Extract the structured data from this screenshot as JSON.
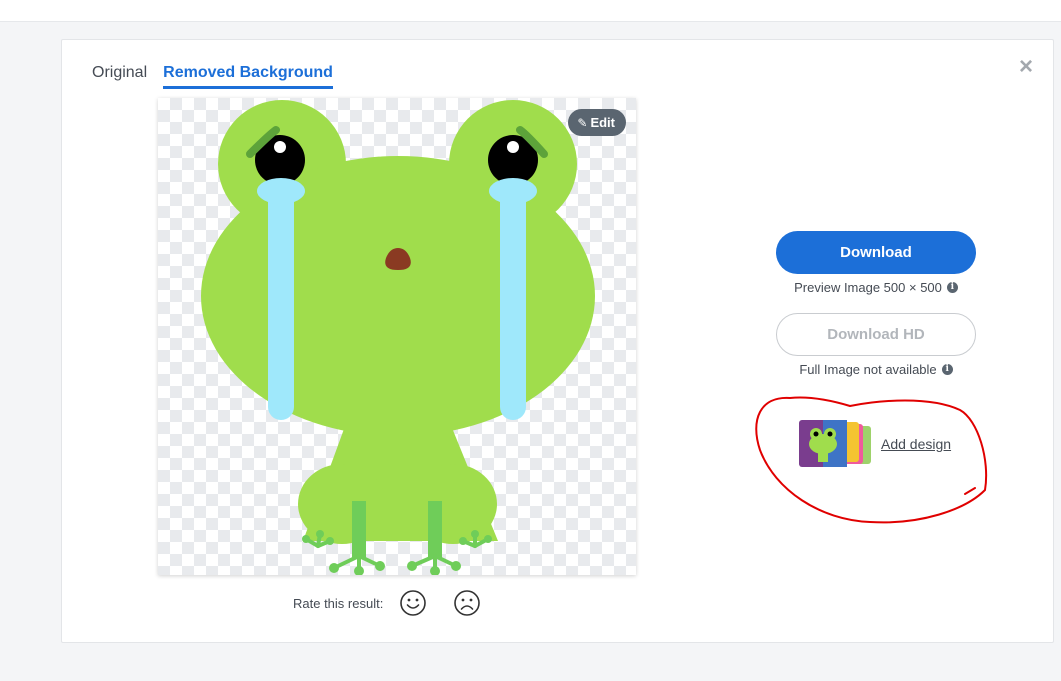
{
  "tabs": [
    {
      "label": "Original",
      "active": false
    },
    {
      "label": "Removed Background",
      "active": true
    }
  ],
  "close_icon": "close-icon",
  "preview": {
    "edit_label": "Edit",
    "edit_icon": "paintbrush-icon"
  },
  "rating": {
    "label": "Rate this result:",
    "happy_icon": "happy-face-icon",
    "sad_icon": "sad-face-icon"
  },
  "download": {
    "label": "Download",
    "note": "Preview Image 500 × 500"
  },
  "download_hd": {
    "label": "Download HD",
    "note": "Full Image not available"
  },
  "add_design": {
    "label": "Add design"
  },
  "colors": {
    "accent": "#1c6fd8",
    "frog": "#a0dd4c",
    "tears": "#9fe8fb",
    "annotation": "#e00000"
  }
}
